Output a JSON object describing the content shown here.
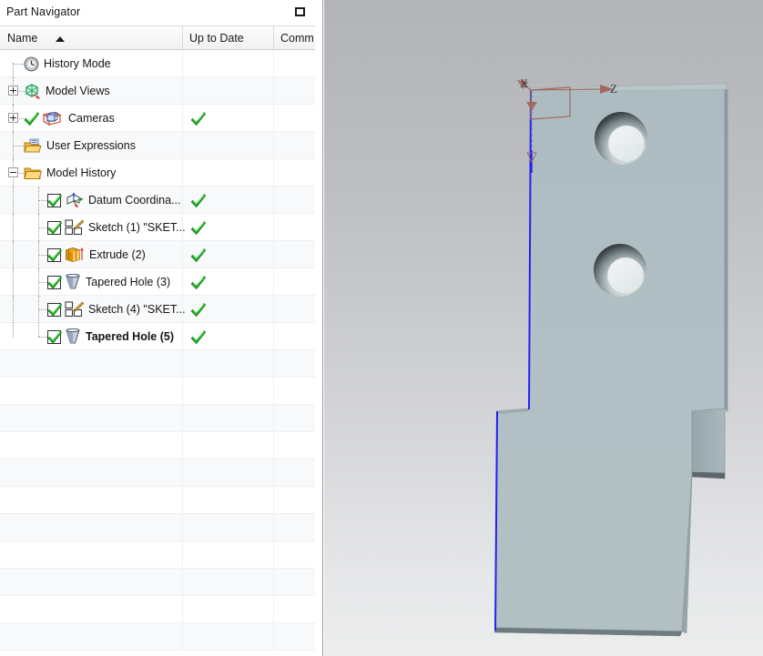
{
  "panel": {
    "title": "Part Navigator",
    "maximize_icon": "restore-window-icon",
    "columns": [
      {
        "key": "name",
        "label": "Name",
        "sorted": true,
        "sort_dir": "asc"
      },
      {
        "key": "up_to_date",
        "label": "Up to Date"
      },
      {
        "key": "comments",
        "label": "Comm"
      }
    ],
    "tree": [
      {
        "label": "History Mode",
        "icon": "clock-icon",
        "indent": 1,
        "expander": "none",
        "checkbox": false,
        "up_to_date": false,
        "bold": false,
        "alt": false
      },
      {
        "label": "Model Views",
        "icon": "model-views-icon",
        "indent": 1,
        "expander": "plus",
        "checkbox": false,
        "up_to_date": false,
        "bold": false,
        "alt": true
      },
      {
        "label": "Cameras",
        "icon": "camera-icon",
        "indent": 1,
        "expander": "plus",
        "checkbox": false,
        "up_to_date": true,
        "pre_tick": true,
        "bold": false,
        "alt": false
      },
      {
        "label": "User Expressions",
        "icon": "folder-expressions-icon",
        "indent": 1,
        "expander": "none",
        "checkbox": false,
        "up_to_date": false,
        "bold": false,
        "alt": true
      },
      {
        "label": "Model History",
        "icon": "folder-icon",
        "indent": 1,
        "expander": "minus",
        "checkbox": false,
        "up_to_date": false,
        "bold": false,
        "alt": false
      },
      {
        "label": "Datum Coordina...",
        "icon": "datum-csys-icon",
        "indent": 2,
        "expander": "none",
        "checkbox": true,
        "up_to_date": true,
        "bold": false,
        "alt": true
      },
      {
        "label": "Sketch (1) \"SKET...",
        "icon": "sketch-icon",
        "indent": 2,
        "expander": "none",
        "checkbox": true,
        "up_to_date": true,
        "bold": false,
        "alt": false
      },
      {
        "label": "Extrude (2)",
        "icon": "extrude-icon",
        "indent": 2,
        "expander": "none",
        "checkbox": true,
        "up_to_date": true,
        "bold": false,
        "alt": true
      },
      {
        "label": "Tapered Hole (3)",
        "icon": "tapered-hole-icon",
        "indent": 2,
        "expander": "none",
        "checkbox": true,
        "up_to_date": true,
        "bold": false,
        "alt": false
      },
      {
        "label": "Sketch (4) \"SKET...",
        "icon": "sketch-icon",
        "indent": 2,
        "expander": "none",
        "checkbox": true,
        "up_to_date": true,
        "bold": false,
        "alt": true
      },
      {
        "label": "Tapered Hole (5)",
        "icon": "tapered-hole-icon",
        "indent": 2,
        "expander": "none",
        "checkbox": true,
        "up_to_date": true,
        "bold": true,
        "alt": false
      }
    ],
    "empty_row_count": 11
  },
  "viewport": {
    "axis_labels": {
      "x": "X",
      "z": "Z"
    },
    "datum_color": "#a06a60",
    "highlight_edge_color": "#2222ee",
    "body_face_color": "#aebdc2",
    "body_side_color": "#8f9ea3",
    "background_top": "#b2b4b7",
    "background_bottom": "#eceded",
    "features": {
      "holes": 2,
      "hole_type": "tapered",
      "datum_csys": "visible",
      "selected_edges": 2
    }
  }
}
